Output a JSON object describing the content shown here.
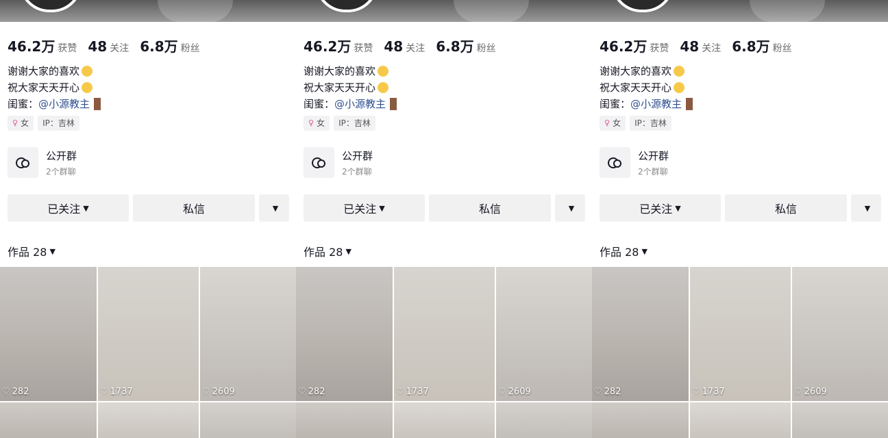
{
  "profile": {
    "stats": [
      {
        "value": "46.2万",
        "label": "获赞"
      },
      {
        "value": "48",
        "label": "关注"
      },
      {
        "value": "6.8万",
        "label": "粉丝"
      }
    ],
    "bio_line1": "谢谢大家的喜欢",
    "bio_line2": "祝大家天天开心",
    "bio_line3_prefix": "闺蜜：",
    "bio_line3_mention": "@小源教主",
    "gender": "女",
    "ip": "IP：吉林"
  },
  "group": {
    "title": "公开群",
    "subtitle": "2个群聊"
  },
  "actions": {
    "follow_label": "已关注",
    "message_label": "私信"
  },
  "works": {
    "label": "作品 28"
  },
  "videos": [
    {
      "likes": "282"
    },
    {
      "likes": "1737"
    },
    {
      "likes": "2609"
    }
  ],
  "colors": {
    "text_primary": "#161823",
    "button_bg": "#f1f1f2",
    "tag_bg": "#f2f2f4",
    "mention": "#2f4f8f"
  }
}
